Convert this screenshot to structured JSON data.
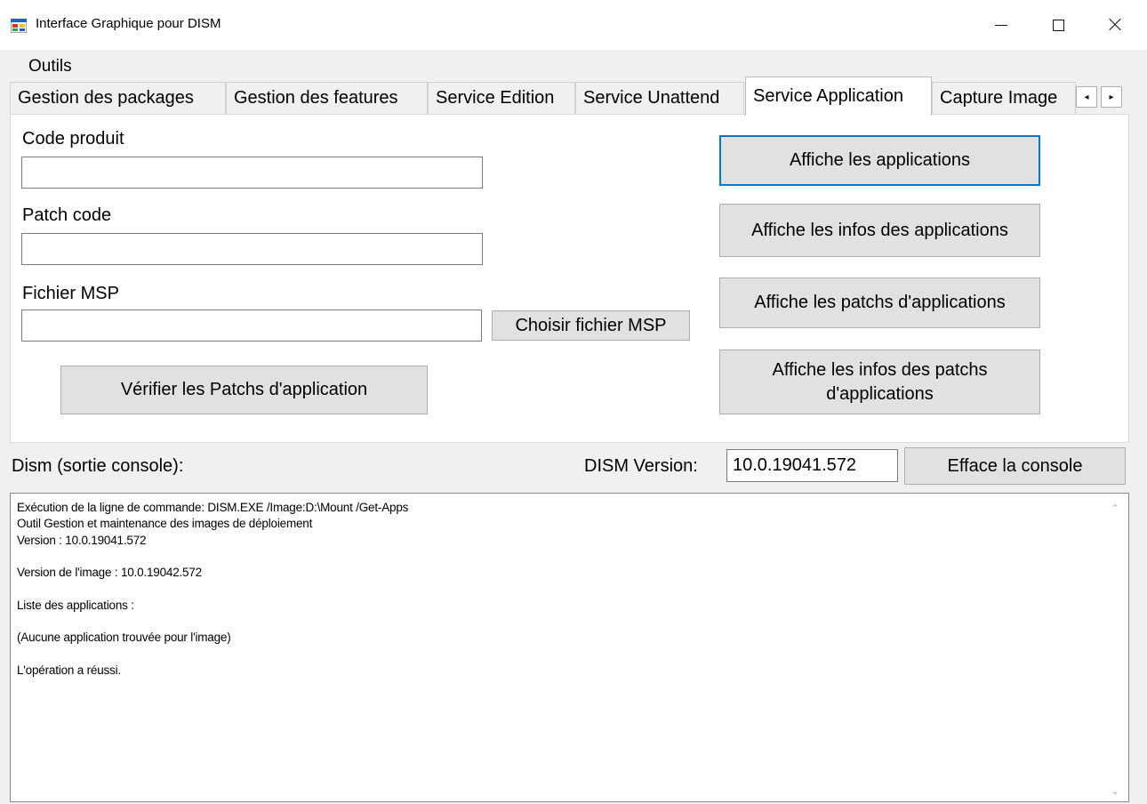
{
  "window": {
    "title": "Interface Graphique pour DISM",
    "icon": "app-window-icon",
    "controls": {
      "minimize": "minimize-icon",
      "maximize": "maximize-icon",
      "close": "close-icon"
    }
  },
  "menu": {
    "items": [
      "Outils"
    ]
  },
  "tabs": [
    {
      "label": "Gestion des packages",
      "active": false
    },
    {
      "label": "Gestion des features",
      "active": false
    },
    {
      "label": "Service Edition",
      "active": false
    },
    {
      "label": "Service Unattend",
      "active": false
    },
    {
      "label": "Service Application",
      "active": true
    },
    {
      "label": "Capture Image",
      "active": false
    }
  ],
  "tab_scroll": {
    "left": "◂",
    "right": "▸"
  },
  "form": {
    "code_produit_label": "Code produit",
    "code_produit_value": "",
    "patch_code_label": "Patch code",
    "patch_code_value": "",
    "fichier_msp_label": "Fichier MSP",
    "fichier_msp_value": "",
    "choose_msp_button": "Choisir fichier MSP",
    "verify_button": "Vérifier les Patchs d'application"
  },
  "actions": {
    "show_apps": "Affiche les applications",
    "show_app_infos": "Affiche les infos des applications",
    "show_app_patches": "Affiche les patchs d'applications",
    "show_patch_infos": "Affiche les infos des patchs d'applications"
  },
  "console_area": {
    "label": "Dism (sortie console):",
    "version_label": "DISM Version:",
    "version_value": "10.0.19041.572",
    "clear_button": "Efface la console",
    "text": "Exécution de la ligne de commande: DISM.EXE /Image:D:\\Mount /Get-Apps\nOutil Gestion et maintenance des images de déploiement\nVersion : 10.0.19041.572\n\nVersion de l'image : 10.0.19042.572\n\nListe des applications :\n\n(Aucune application trouvée pour l'image)\n\nL'opération a réussi."
  },
  "colors": {
    "accent": "#0078d7",
    "button": "#e1e1e1",
    "background": "#f0f0f0"
  }
}
